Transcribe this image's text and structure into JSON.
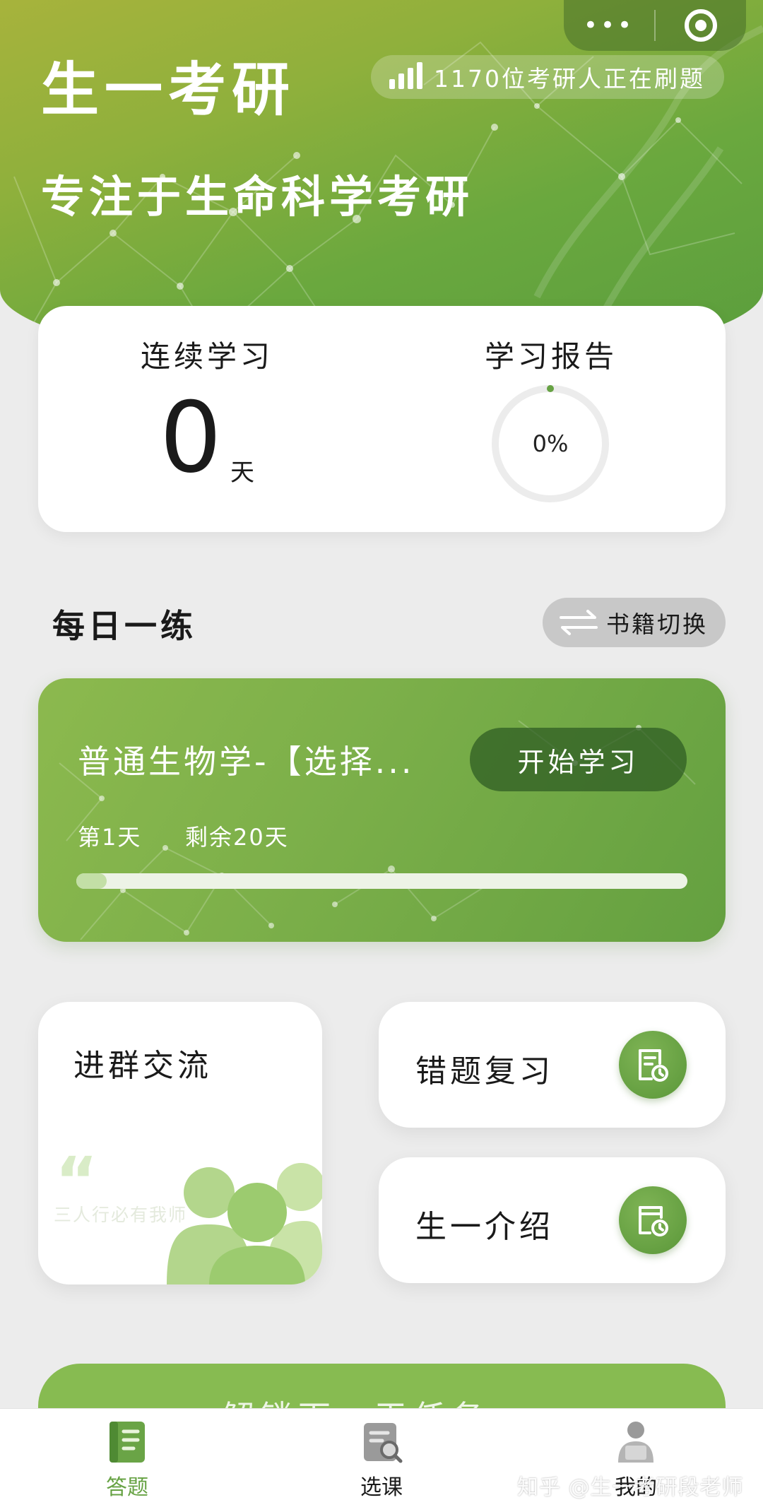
{
  "header": {
    "title": "生一考研",
    "live_count_text": "1170位考研人正在刷题",
    "subtitle": "专注于生命科学考研"
  },
  "capsule": {
    "more_icon": "more-dots-icon",
    "close_icon": "target-icon"
  },
  "stats": {
    "streak_label": "连续学习",
    "streak_value": "0",
    "streak_unit": "天",
    "report_label": "学习报告",
    "report_progress_text": "0%",
    "report_progress": 0
  },
  "daily": {
    "section_title": "每日一练",
    "switch_label": "书籍切换",
    "course_title": "普通生物学-【选择...",
    "start_label": "开始学习",
    "day_text": "第1天",
    "remaining_text": "剩余20天",
    "progress": 0.05
  },
  "tiles": {
    "group_title": "进群交流",
    "group_quote_mark": "“",
    "group_quote_text": "三人行必有我师",
    "review_title": "错题复习",
    "intro_title": "生一介绍"
  },
  "banner": {
    "text": "解锁下一天任务"
  },
  "tabbar": {
    "items": [
      {
        "label": "答题",
        "icon": "book-icon",
        "active": true
      },
      {
        "label": "选课",
        "icon": "course-search-icon",
        "active": false
      },
      {
        "label": "我的",
        "icon": "profile-icon",
        "active": false
      }
    ]
  },
  "watermark": "知乎 @生一考研段老师",
  "colors": {
    "accent": "#66a243",
    "hero_start": "#a7b33c",
    "hero_end": "#5a9d3d",
    "card_bg": "#ffffff",
    "page_bg": "#ececec"
  }
}
